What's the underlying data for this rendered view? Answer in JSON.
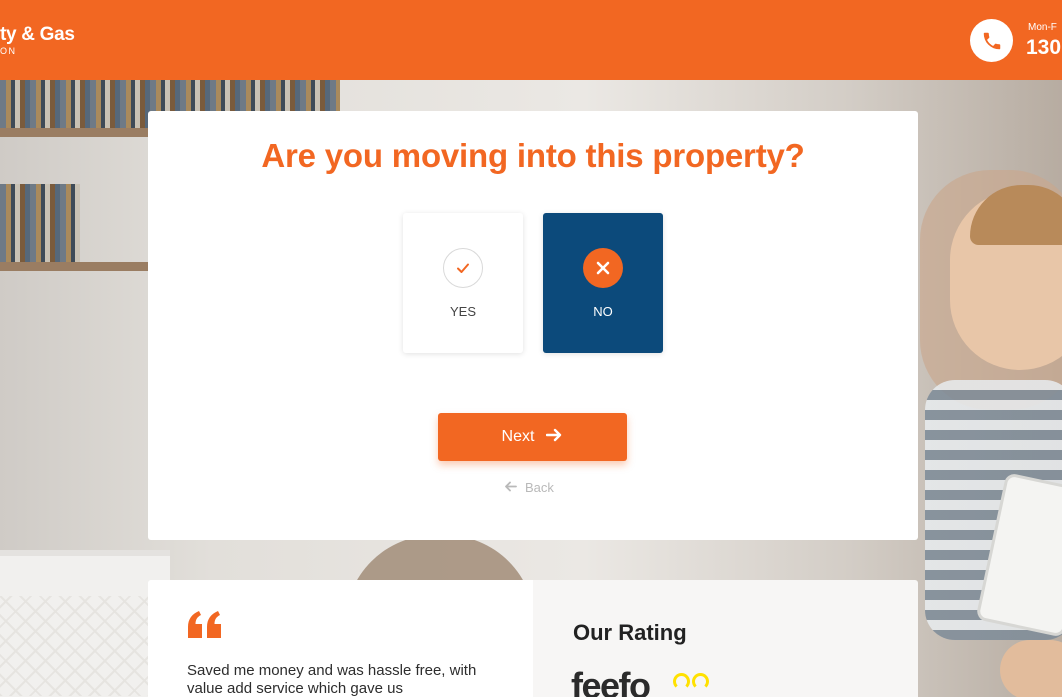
{
  "header": {
    "brand_name": "ty & Gas",
    "brand_sub": "ON",
    "phone_hours": "Mon-F",
    "phone_number": "130",
    "accent_color": "#f26722"
  },
  "question": {
    "title": "Are you moving into this property?",
    "options": [
      {
        "label": "YES",
        "icon": "check-icon",
        "selected": false
      },
      {
        "label": "NO",
        "icon": "x-icon",
        "selected": true
      }
    ],
    "selected_color": "#0c4a7b"
  },
  "actions": {
    "next_label": "Next",
    "back_label": "Back"
  },
  "testimonial": {
    "text": "Saved me money and was hassle free, with value add service which gave us"
  },
  "rating": {
    "title": "Our Rating",
    "provider": "feefo"
  }
}
